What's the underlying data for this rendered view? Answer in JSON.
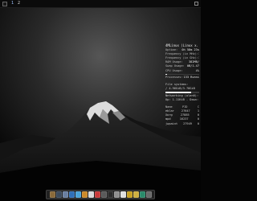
{
  "panel": {
    "workspaces": [
      {
        "label": "1",
        "active": true
      },
      {
        "label": "2",
        "active": false
      }
    ]
  },
  "conky": {
    "header": "4MLinux (Linux x. 4.1",
    "system": [
      {
        "label": "Uptime:",
        "value": "0h 58m 23s"
      },
      {
        "label": "Frequency (in MHz):",
        "value": "1"
      },
      {
        "label": "Frequency (in GHz):",
        "value": "1"
      },
      {
        "label": "RAM Usage:",
        "value": "382MB/"
      },
      {
        "label": "Swap Usage:",
        "value": "0B/1.47"
      },
      {
        "label": "CPU Usage:",
        "value": "4%"
      },
      {
        "label": "Processes:",
        "value": "133  Runni"
      }
    ],
    "cpu_percent": 4,
    "filesystem_label": "File systems:",
    "filesystem_value": "/ 4.96GiB/3.78GiB",
    "filesystem_fraction": 0.76,
    "networking_label": "Networking (wlan0):",
    "networking_value": "Up: 1.11KiB  - Down: 2",
    "processes_header": {
      "name": "Name",
      "pid": "PID",
      "cpu": "C"
    },
    "processes": [
      {
        "name": "eblar",
        "pid": "27647",
        "cpu": "1"
      },
      {
        "name": "Xorg",
        "pid": "27885",
        "cpu": "0"
      },
      {
        "name": "mpd",
        "pid": "16237",
        "cpu": "0"
      },
      {
        "name": "jwpaint",
        "pid": "27949",
        "cpu": "0"
      }
    ]
  },
  "dock": {
    "icons": [
      {
        "name": "file-manager-icon",
        "color": "#8a6a3a"
      },
      {
        "name": "terminal-icon",
        "color": "#3b4a5c"
      },
      {
        "name": "text-editor-icon",
        "color": "#6a7fa0"
      },
      {
        "name": "calculator-icon",
        "color": "#2f6fb8"
      },
      {
        "name": "image-viewer-icon",
        "color": "#4aa3d9"
      },
      {
        "name": "media-player-icon",
        "color": "#cc8a2a"
      },
      {
        "name": "firefox-icon",
        "color": "#d9d9d9"
      },
      {
        "name": "video-icon",
        "color": "#c93a3a"
      },
      {
        "name": "chat-icon",
        "color": "#5a5a5a"
      },
      {
        "name": "paint-icon",
        "color": "#2a2a2a"
      },
      {
        "name": "settings-icon",
        "color": "#8f8f8f"
      },
      {
        "name": "game-icon",
        "color": "#e0e0e0"
      },
      {
        "name": "archive-icon",
        "color": "#c8a020"
      },
      {
        "name": "music-icon",
        "color": "#d0b040"
      },
      {
        "name": "office-icon",
        "color": "#2a8a6a"
      },
      {
        "name": "trash-icon",
        "color": "#6a6a6a"
      }
    ]
  }
}
